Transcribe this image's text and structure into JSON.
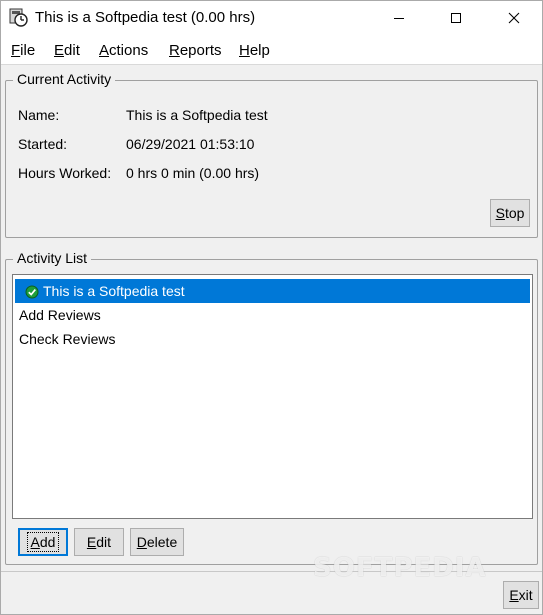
{
  "window": {
    "title": "This is a Softpedia test (0.00 hrs)",
    "icons": {
      "app": "clock-app-icon",
      "minimize": "minimize-icon",
      "maximize": "maximize-icon",
      "close": "close-icon"
    }
  },
  "menu": {
    "file": {
      "mnemonic": "F",
      "rest": "ile"
    },
    "edit": {
      "mnemonic": "E",
      "rest": "dit"
    },
    "actions": {
      "mnemonic": "A",
      "rest": "ctions"
    },
    "reports": {
      "mnemonic": "R",
      "rest": "eports"
    },
    "help": {
      "mnemonic": "H",
      "rest": "elp"
    }
  },
  "current_activity": {
    "group_label": "Current Activity",
    "name_label": "Name:",
    "name_value": "This is a Softpedia test",
    "started_label": "Started:",
    "started_value": "06/29/2021 01:53:10",
    "hours_label": "Hours Worked:",
    "hours_value": "0 hrs 0 min (0.00 hrs)",
    "stop_button": {
      "mnemonic": "S",
      "rest": "top"
    }
  },
  "activity_list": {
    "group_label": "Activity List",
    "items": [
      {
        "label": "This is a Softpedia test",
        "selected": true,
        "icon": "check-icon"
      },
      {
        "label": "Add Reviews",
        "selected": false
      },
      {
        "label": "Check Reviews",
        "selected": false
      }
    ],
    "add_button": {
      "mnemonic": "A",
      "rest": "dd"
    },
    "edit_button": {
      "mnemonic": "E",
      "rest": "dit"
    },
    "delete_button": {
      "mnemonic": "D",
      "rest": "elete"
    }
  },
  "exit_button": {
    "mnemonic": "E",
    "rest": "xit"
  },
  "watermark": "SOFTPEDIA",
  "colors": {
    "selection": "#0078d7",
    "window_bg": "#f0f0f0",
    "check_green": "#1e9e3a"
  }
}
